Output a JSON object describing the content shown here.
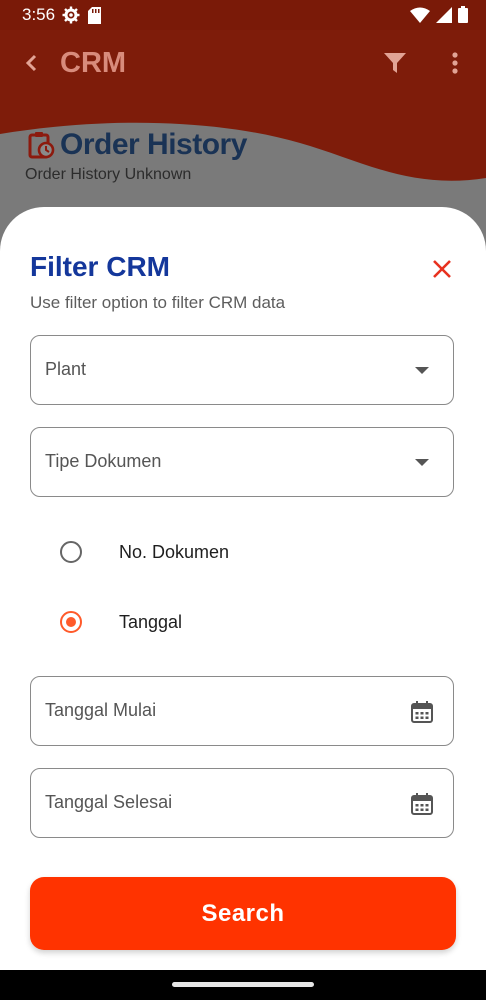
{
  "status_bar": {
    "time": "3:56"
  },
  "app_bar": {
    "title": "CRM",
    "back_icon": "chevron-left-icon",
    "filter_icon": "funnel-icon",
    "more_icon": "more-vert-icon"
  },
  "header": {
    "title": "Order History",
    "subtitle": "Order History Unknown",
    "icon": "clipboard-clock-icon"
  },
  "filter_sheet": {
    "title": "Filter CRM",
    "subtitle": "Use filter option to filter CRM data",
    "close_icon": "close-icon",
    "plant": {
      "label": "Plant"
    },
    "tipe_dokumen": {
      "label": "Tipe Dokumen"
    },
    "radio_options": [
      {
        "label": "No. Dokumen",
        "selected": false
      },
      {
        "label": "Tanggal",
        "selected": true
      }
    ],
    "tanggal_mulai": {
      "label": "Tanggal Mulai"
    },
    "tanggal_selesai": {
      "label": "Tanggal Selesai"
    },
    "search_button": "Search"
  },
  "colors": {
    "accent": "#ff3300",
    "title_blue": "#14379b",
    "radio_accent": "#ff5a2a",
    "app_bar": "#7e1c0a"
  }
}
